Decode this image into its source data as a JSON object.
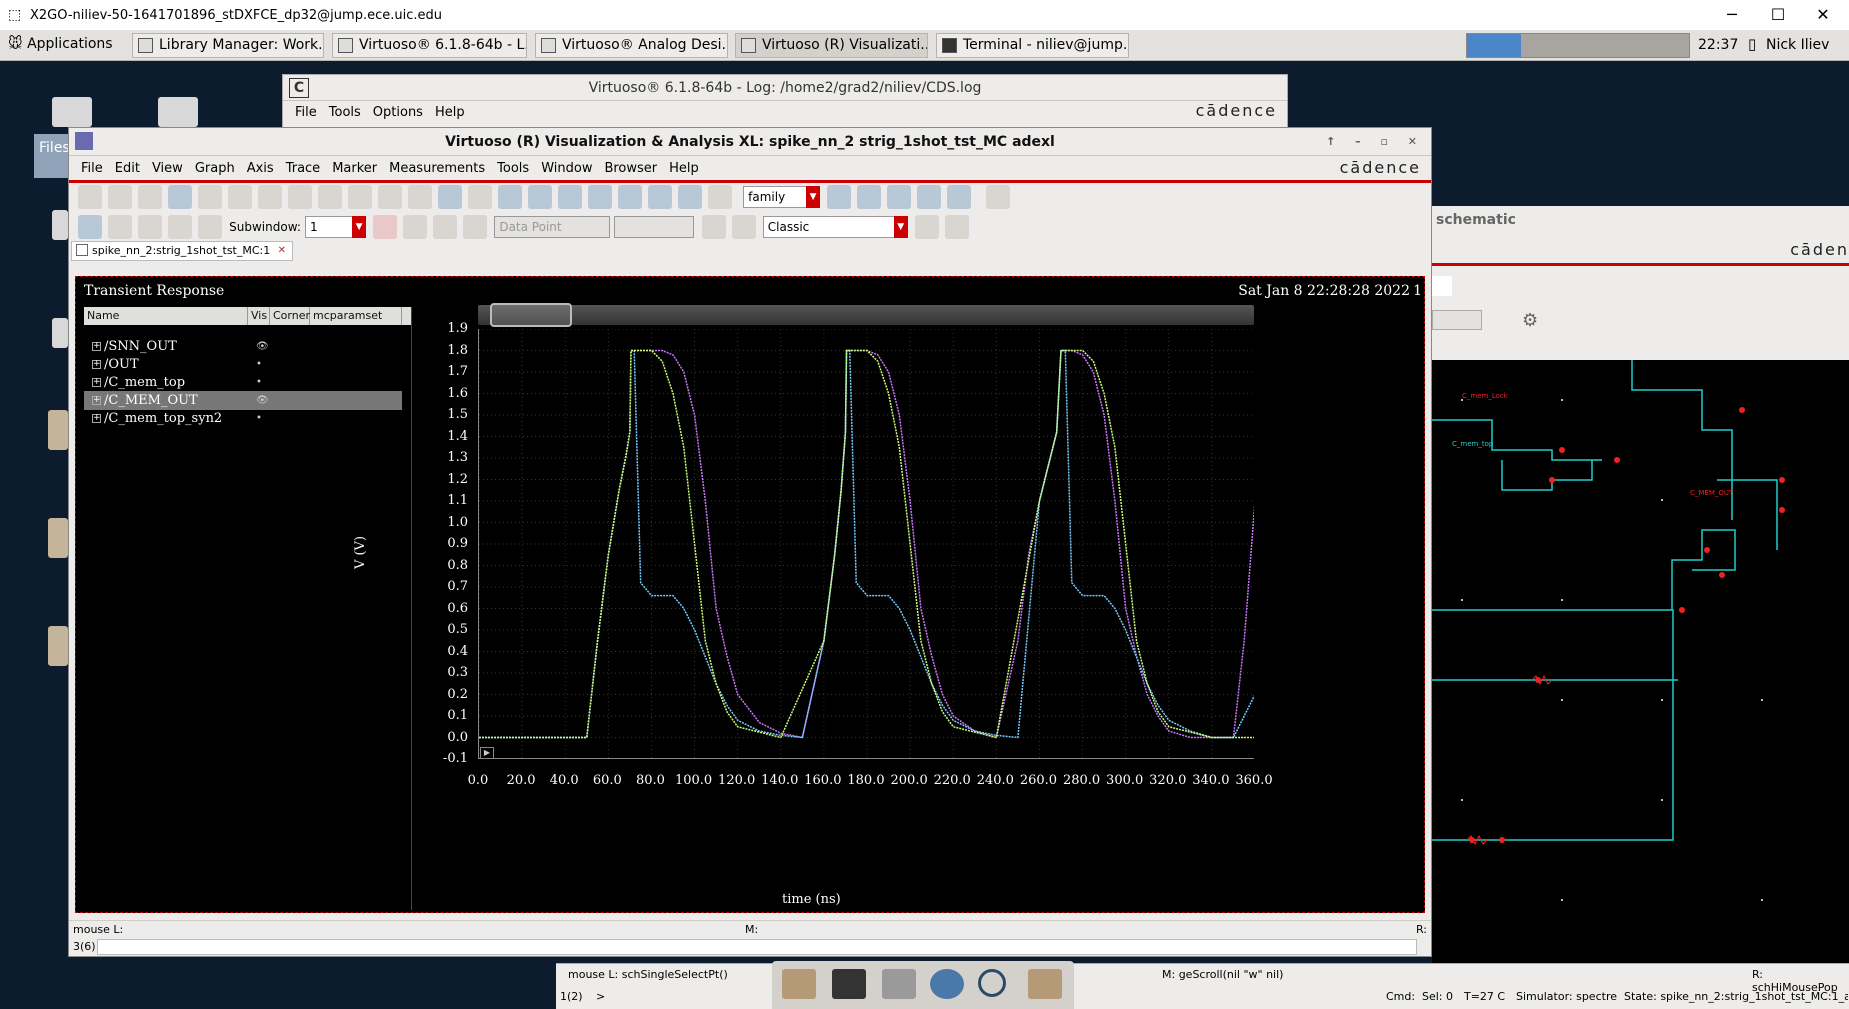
{
  "titlebar": {
    "title": "X2GO-niliev-50-1641701896_stDXFCE_dp32@jump.ece.uic.edu",
    "min": "─",
    "max": "☐",
    "close": "✕"
  },
  "taskbar": {
    "applications": "Applications",
    "tasks": [
      "Library Manager: Work...",
      "Virtuoso® 6.1.8-64b - L...",
      "Virtuoso® Analog Desi...",
      "Virtuoso (R) Visualizati...",
      "Terminal - niliev@jump..."
    ],
    "clock": "22:37",
    "user": "Nick Iliev"
  },
  "desktop": {
    "files_label": "Files"
  },
  "logwin": {
    "title": "Virtuoso® 6.1.8-64b - Log: /home2/grad2/niliev/CDS.log",
    "menu": [
      "File",
      "Tools",
      "Options",
      "Help"
    ],
    "brand": "cādence"
  },
  "viva": {
    "title": "Virtuoso (R) Visualization & Analysis XL: spike_nn_2 strig_1shot_tst_MC adexl",
    "menu": [
      "File",
      "Edit",
      "View",
      "Graph",
      "Axis",
      "Trace",
      "Marker",
      "Measurements",
      "Tools",
      "Window",
      "Browser",
      "Help"
    ],
    "brand": "cādence",
    "toolbar": {
      "family_value": "family",
      "subwindow_label": "Subwindow:",
      "subwindow_value": "1",
      "datapoint": "Data Point",
      "style_value": "Classic"
    },
    "tab": "spike_nn_2:strig_1shot_tst_MC:1",
    "status_left": "mouse L:",
    "status_mid": "M:",
    "status_right": "R:",
    "cmd_count": "3(6)"
  },
  "plot": {
    "title": "Transient Response",
    "datetime": "Sat Jan 8 22:28:28 2022",
    "subwindow_num": "1",
    "columns": [
      "Name",
      "Vis",
      "Corner",
      "mcparamset"
    ],
    "signals": [
      {
        "name": "/SNN_OUT",
        "vis": "👁"
      },
      {
        "name": "/OUT",
        "vis": "•"
      },
      {
        "name": "/C_mem_top",
        "vis": "•"
      },
      {
        "name": "/C_MEM_OUT",
        "vis": "👁"
      },
      {
        "name": "/C_mem_top_syn2",
        "vis": "•"
      }
    ]
  },
  "chart_data": {
    "type": "line",
    "title": "Transient Response",
    "xlabel": "time (ns)",
    "ylabel": "V (V)",
    "xlim": [
      0,
      360
    ],
    "ylim": [
      -0.1,
      1.9
    ],
    "xticks": [
      "0.0",
      "20.0",
      "40.0",
      "60.0",
      "80.0",
      "100.0",
      "120.0",
      "140.0",
      "160.0",
      "180.0",
      "200.0",
      "220.0",
      "240.0",
      "260.0",
      "280.0",
      "300.0",
      "320.0",
      "340.0",
      "360.0"
    ],
    "yticks": [
      "-0.1",
      "0.0",
      "0.1",
      "0.2",
      "0.3",
      "0.4",
      "0.5",
      "0.6",
      "0.7",
      "0.8",
      "0.9",
      "1.0",
      "1.1",
      "1.2",
      "1.3",
      "1.4",
      "1.5",
      "1.6",
      "1.7",
      "1.8",
      "1.9"
    ],
    "series": [
      {
        "color": "#c7f",
        "x": [
          0,
          50,
          55,
          60,
          65,
          68,
          70,
          70.5,
          72,
          78,
          85,
          90,
          95,
          100,
          105,
          110,
          115,
          120,
          130,
          140,
          150,
          160,
          165,
          168,
          170,
          170.5,
          175,
          180,
          185,
          190,
          195,
          200,
          205,
          210,
          215,
          220,
          230,
          240,
          250,
          255,
          260,
          265,
          268,
          270,
          270.5,
          275,
          280,
          285,
          290,
          295,
          300,
          305,
          310,
          315,
          320,
          330,
          340,
          350,
          355,
          360
        ],
        "y": [
          0,
          0,
          0.45,
          0.85,
          1.15,
          1.3,
          1.42,
          1.8,
          1.8,
          1.8,
          1.8,
          1.78,
          1.7,
          1.5,
          1.1,
          0.6,
          0.38,
          0.2,
          0.07,
          0.02,
          0,
          0.45,
          0.85,
          1.15,
          1.42,
          1.8,
          1.8,
          1.8,
          1.78,
          1.7,
          1.5,
          1.1,
          0.6,
          0.38,
          0.2,
          0.1,
          0.03,
          0,
          0.45,
          0.85,
          1.1,
          1.3,
          1.42,
          1.8,
          1.8,
          1.8,
          1.78,
          1.7,
          1.5,
          1.1,
          0.6,
          0.38,
          0.2,
          0.1,
          0.03,
          0,
          0,
          0,
          0.45,
          1.1
        ]
      },
      {
        "color": "#7cf",
        "x": [
          0,
          50,
          55,
          60,
          65,
          68,
          70,
          70.5,
          72,
          75,
          80,
          90,
          95,
          100,
          110,
          115,
          120,
          130,
          140,
          150,
          160,
          165,
          168,
          170,
          170.5,
          172,
          175,
          180,
          190,
          195,
          200,
          210,
          215,
          220,
          230,
          240,
          250,
          260,
          265,
          268,
          270,
          270.5,
          272,
          275,
          280,
          290,
          295,
          300,
          310,
          315,
          320,
          330,
          340,
          350,
          360
        ],
        "y": [
          0,
          0,
          0.45,
          0.85,
          1.15,
          1.3,
          1.42,
          1.8,
          1.8,
          0.72,
          0.66,
          0.66,
          0.6,
          0.5,
          0.25,
          0.15,
          0.08,
          0.03,
          0.01,
          0,
          0.45,
          0.85,
          1.15,
          1.42,
          1.8,
          1.8,
          0.72,
          0.66,
          0.66,
          0.6,
          0.5,
          0.25,
          0.15,
          0.08,
          0.03,
          0.01,
          0,
          1.1,
          1.3,
          1.42,
          1.8,
          1.8,
          1.8,
          0.72,
          0.66,
          0.66,
          0.6,
          0.5,
          0.25,
          0.15,
          0.08,
          0.03,
          0,
          0,
          0.2
        ]
      },
      {
        "color": "#cf7",
        "x": [
          0,
          50,
          55,
          60,
          65,
          68,
          70,
          70.5,
          72,
          75,
          80,
          85,
          90,
          95,
          100,
          105,
          110,
          115,
          120,
          140,
          160,
          165,
          168,
          170,
          170.5,
          175,
          180,
          185,
          190,
          195,
          200,
          205,
          210,
          215,
          220,
          240,
          260,
          265,
          268,
          270,
          270.5,
          275,
          280,
          285,
          290,
          295,
          300,
          305,
          310,
          315,
          320,
          340,
          360
        ],
        "y": [
          0,
          0,
          0.45,
          0.85,
          1.15,
          1.3,
          1.42,
          1.8,
          1.8,
          1.8,
          1.8,
          1.75,
          1.6,
          1.35,
          0.9,
          0.45,
          0.25,
          0.12,
          0.05,
          0,
          0.45,
          0.85,
          1.15,
          1.42,
          1.8,
          1.8,
          1.8,
          1.75,
          1.6,
          1.35,
          0.9,
          0.45,
          0.25,
          0.12,
          0.05,
          0,
          1.1,
          1.3,
          1.42,
          1.8,
          1.8,
          1.8,
          1.8,
          1.75,
          1.6,
          1.35,
          0.9,
          0.45,
          0.25,
          0.12,
          0.05,
          0,
          0
        ]
      }
    ]
  },
  "schematic": {
    "title": "schematic",
    "brand": "cāden",
    "labels": [
      "C_mem_Lock",
      "C_mem_top",
      "C_MEM_OUT"
    ]
  },
  "status": {
    "mouse_l": "mouse L: schSingleSelectPt()",
    "mouse_m": "M: geScroll(nil \"w\" nil)",
    "mouse_r": "R: schHiMousePop",
    "count": "1(2)",
    "prompt": ">",
    "cmd": "Cmd:",
    "sel": "Sel: 0",
    "temp": "T=27 C",
    "sim": "Simulator: spectre",
    "state": "State: spike_nn_2:strig_1shot_tst_MC:1_acti"
  }
}
